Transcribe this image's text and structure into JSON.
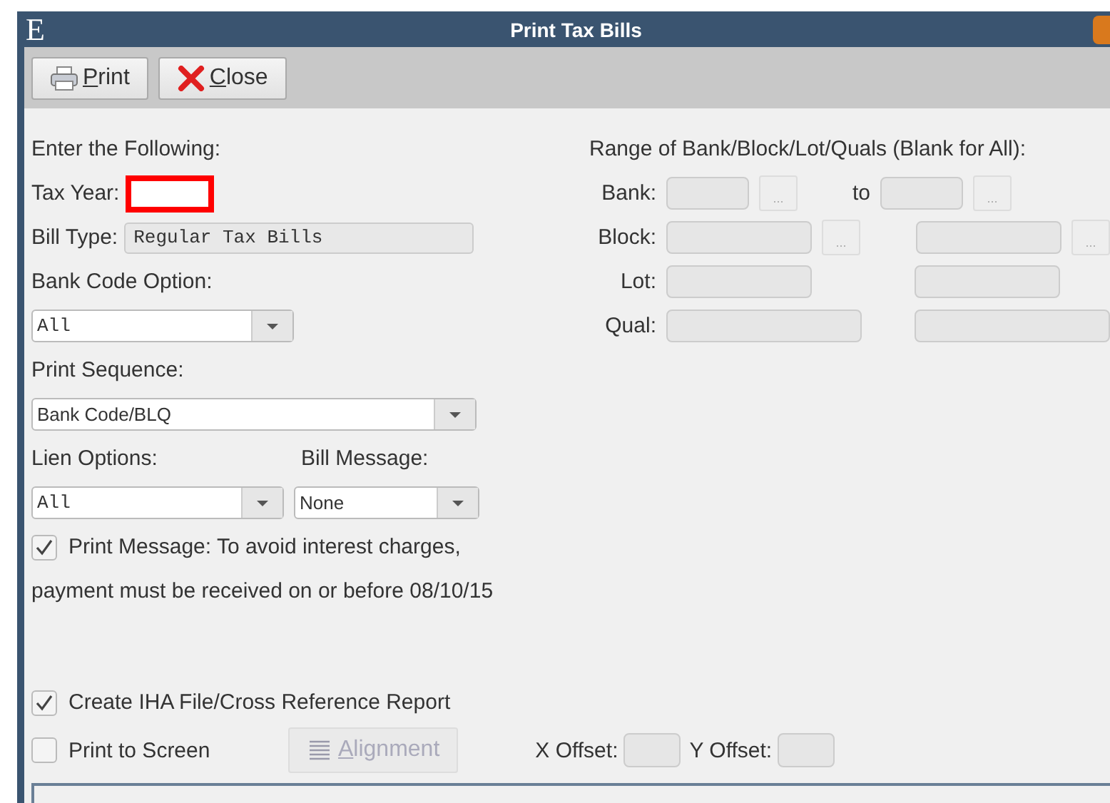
{
  "window": {
    "app_letter": "E",
    "title": "Print Tax Bills"
  },
  "toolbar": [
    {
      "label": "Print",
      "underlined_first_letter": true,
      "kind": "print"
    },
    {
      "label": "Close",
      "underlined_first_letter": true,
      "kind": "close"
    }
  ],
  "form": {
    "heading": "Enter the Following:",
    "tax_year": {
      "label": "Tax Year:",
      "highlighted": true
    },
    "bill_type": {
      "label": "Bill Type:",
      "value": "Regular Tax Bills"
    },
    "bank_code_option": {
      "label": "Bank Code Option:",
      "value": "All"
    },
    "print_sequence": {
      "label": "Print Sequence:",
      "value": "Bank Code/BLQ"
    },
    "lien_options": {
      "label": "Lien Options:",
      "value": "All"
    },
    "bill_message": {
      "label": "Bill Message:",
      "value": "None"
    },
    "print_message": {
      "label": "Print Message: To avoid interest charges,",
      "checked": true
    },
    "message_line": "payment must be received on or before 08/10/15"
  },
  "range": {
    "heading": "Range of Bank/Block/Lot/Quals (Blank for All):",
    "to_label": "to",
    "rows": [
      {
        "label": "Bank:",
        "kind": "bank",
        "lookup_button": "..."
      },
      {
        "label": "Block:",
        "kind": "block",
        "lookup_button": "..."
      },
      {
        "label": "Lot:",
        "kind": "lot"
      },
      {
        "label": "Qual:",
        "kind": "qual"
      }
    ]
  },
  "options": {
    "create_iha": {
      "label": "Create IHA File/Cross Reference Report",
      "checked": true
    },
    "print_to_screen": {
      "label": "Print to Screen",
      "checked": false
    },
    "alignment": {
      "label": "Alignment",
      "underlined_first_letter": true,
      "disabled": true
    },
    "x_offset": "X Offset:",
    "y_offset": "Y Offset:"
  }
}
